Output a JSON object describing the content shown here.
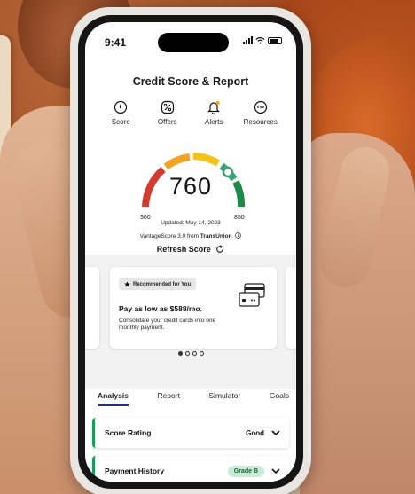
{
  "status_bar": {
    "time": "9:41"
  },
  "header": {
    "title": "Credit Score & Report"
  },
  "nav": [
    {
      "label": "Score",
      "icon": "score-icon"
    },
    {
      "label": "Offers",
      "icon": "percent-icon"
    },
    {
      "label": "Alerts",
      "icon": "bell-icon"
    },
    {
      "label": "Resources",
      "icon": "more-icon"
    }
  ],
  "score": {
    "value": "760",
    "min_label": "300",
    "max_label": "850",
    "updated": "Updated: May 14, 2023",
    "source_prefix": "VantageScore 3.0 from ",
    "source_bureau": "TransUnion",
    "refresh_label": "Refresh Score",
    "gauge_colors": [
      "#d33b2c",
      "#f2a321",
      "#f4c319",
      "#3aa373",
      "#1d8a4a"
    ]
  },
  "offer_card": {
    "badge": "Recommended for You",
    "title": "Pay as low as $588/mo.",
    "description": "Consolidate your credit cards into one monthly payment."
  },
  "carousel": {
    "active_index": 0,
    "count": 4
  },
  "tabs": [
    {
      "label": "Analysis",
      "active": true
    },
    {
      "label": "Report",
      "active": false
    },
    {
      "label": "Simulator",
      "active": false
    },
    {
      "label": "Goals",
      "active": false
    }
  ],
  "rows": [
    {
      "label": "Score Rating",
      "value": "Good"
    },
    {
      "label": "Payment History",
      "grade": "Grade B"
    }
  ],
  "accent": {
    "green": "#1c9a5a",
    "tab_underline": "#2a2f7a"
  }
}
